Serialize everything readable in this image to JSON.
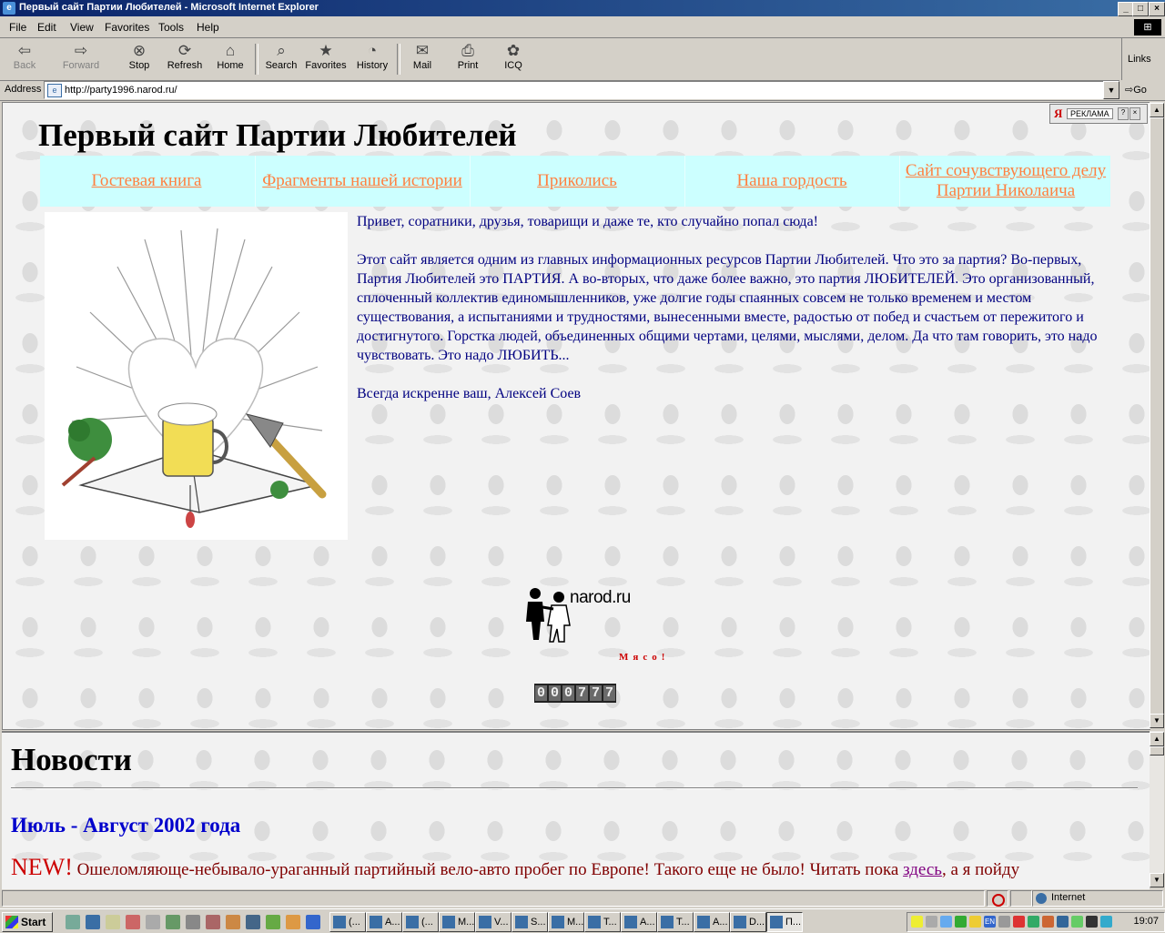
{
  "window": {
    "title": "Первый сайт Партии Любителей - Microsoft Internet Explorer",
    "controls": [
      "_",
      "□",
      "×"
    ]
  },
  "menu": [
    "File",
    "Edit",
    "View",
    "Favorites",
    "Tools",
    "Help"
  ],
  "toolbar": {
    "buttons": [
      {
        "label": "Back",
        "icon": "back-arrow-icon",
        "enabled": false
      },
      {
        "label": "Forward",
        "icon": "forward-arrow-icon",
        "enabled": false
      },
      {
        "label": "Stop",
        "icon": "stop-icon",
        "enabled": true
      },
      {
        "label": "Refresh",
        "icon": "refresh-icon",
        "enabled": true
      },
      {
        "label": "Home",
        "icon": "home-icon",
        "enabled": true
      },
      {
        "label": "Search",
        "icon": "search-icon",
        "enabled": true
      },
      {
        "label": "Favorites",
        "icon": "favorites-icon",
        "enabled": true
      },
      {
        "label": "History",
        "icon": "history-icon",
        "enabled": true
      },
      {
        "label": "Mail",
        "icon": "mail-icon",
        "enabled": true
      },
      {
        "label": "Print",
        "icon": "print-icon",
        "enabled": true
      },
      {
        "label": "ICQ",
        "icon": "icq-flower-icon",
        "enabled": true
      }
    ],
    "links_label": "Links"
  },
  "address": {
    "label": "Address",
    "url": "http://party1996.narod.ru/",
    "go_label": "Go"
  },
  "page": {
    "title": "Первый сайт Партии Любителей",
    "nav": [
      "Гостевая книга",
      "Фрагменты нашей истории",
      "Приколись",
      "Наша гордость",
      "Сайт сочувствующего делу Партии Николаича"
    ],
    "greeting": "Привет, соратники, друзья, товарищи и даже те, кто случайно попал сюда!",
    "body": "Этот сайт является одним из главных информационных ресурсов Партии Любителей. Что это за партия? Во-первых, Партия Любителей это ПАРТИЯ. А во-вторых, что даже более важно, это партия ЛЮБИТЕЛЕЙ. Это организованный, сплоченный коллектив единомышленников, уже долгие годы спаянных совсем не только временем и местом существования, а испытаниями и трудностями, вынесенными вместе, радостью от побед и счастьем от пережитого и достигнутого. Горстка людей, объединенных общими чертами, целями, мыслями, делом. Да что там говорить, это надо чувствовать. Это надо ЛЮБИТЬ...",
    "signature": "Всегда искренне ваш, Алексей Соев",
    "narod_logo_text": "narod.ru",
    "myaso": "Мясо!",
    "counter": "000777",
    "ad_label": "РЕКЛАМА",
    "ad_logo": "Я"
  },
  "news": {
    "heading": "Новости",
    "date": "Июль - Август 2002 года",
    "new_tag": "NEW!",
    "text_before": "Ошеломляюще-небывало-ураганный партийный вело-авто пробег по Европе! Такого еще не было! Читать пока ",
    "link": "здесь",
    "text_after": ", а я пойду"
  },
  "statusbar": {
    "zone": "Internet"
  },
  "taskbar": {
    "start": "Start",
    "tasks": [
      "(...",
      "A...",
      "(...",
      "M...",
      "V...",
      "S...",
      "M...",
      "T...",
      "A...",
      "T...",
      "A...",
      "D...",
      "П..."
    ],
    "clock": "19:07",
    "lang": "EN"
  }
}
